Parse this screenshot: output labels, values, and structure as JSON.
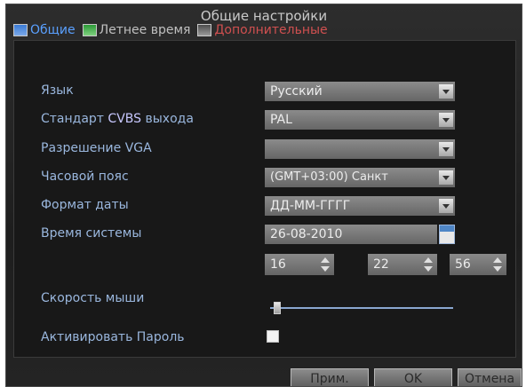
{
  "window": {
    "title": "Общие настройки"
  },
  "tabs": [
    {
      "label": "Общие",
      "active": true
    },
    {
      "label": "Летнее время",
      "active": false
    },
    {
      "label": "Дополнительные",
      "active": false
    }
  ],
  "settings": {
    "language": {
      "label": "Язык",
      "value": "Русский"
    },
    "cvbs_standard": {
      "label_pre": "Стандарт ",
      "label_hl": "CVBS",
      "label_post": " выхода",
      "value": "PAL"
    },
    "vga_resolution": {
      "label": "Разрешение VGA",
      "value": ""
    },
    "time_zone": {
      "label": "Часовой пояс",
      "value": "(GMT+03:00) Санкт"
    },
    "date_format": {
      "label": "Формат даты",
      "value": "ДД-ММ-ГГГГ"
    },
    "system_time": {
      "label": "Время системы",
      "date": "26-08-2010",
      "hour": "16",
      "minute": "22",
      "second": "56"
    },
    "mouse_speed": {
      "label": "Скорость мыши",
      "level": 0.02
    },
    "enable_password": {
      "label": "Активировать Пароль",
      "checked": false
    }
  },
  "buttons": {
    "apply": "Прим.",
    "ok": "OK",
    "cancel": "Отмена"
  },
  "colors": {
    "label": "#9ab7de",
    "active_tab": "#5aa0ff",
    "accent_tab": "#d05050"
  },
  "icons": {
    "tab_general": "monitor-icon",
    "tab_dst": "monitor-icon",
    "tab_advanced": "monitor-icon",
    "dropdown": "chevron-down-icon",
    "calendar": "calendar-icon",
    "spinner": "spinner-arrows-icon"
  }
}
